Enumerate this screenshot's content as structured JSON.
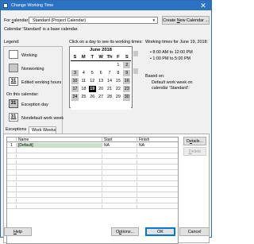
{
  "window": {
    "title": "Change Working Time"
  },
  "for_calendar": {
    "label_pre": "For ",
    "label_key": "c",
    "label_post": "alendar:",
    "value": "Standard (Project Calendar)",
    "note": "Calendar 'Standard' is a base calendar."
  },
  "create_new_calendar": {
    "pre": "Create ",
    "key": "N",
    "post": "ew Calendar ..."
  },
  "legend": {
    "title": "Legend:",
    "items": [
      {
        "label": "Working",
        "glyph": ""
      },
      {
        "label": "Nonworking",
        "glyph": ""
      },
      {
        "label": "Edited working hours",
        "glyph": "31"
      }
    ],
    "on_this_calendar": "On this calendar:",
    "calendar_items": [
      {
        "label": "Exception day",
        "glyph": "31"
      },
      {
        "label": "Nondefault work week",
        "glyph": "31"
      }
    ]
  },
  "calendar": {
    "instruction": "Click on a day to see its working times:",
    "month": "June 2018",
    "day_headers": [
      "S",
      "M",
      "T",
      "W",
      "Th",
      "F",
      "S"
    ],
    "weeks": [
      [
        "",
        "",
        "",
        "",
        "",
        "1",
        "2"
      ],
      [
        "3",
        "4",
        "5",
        "6",
        "7",
        "8",
        "9"
      ],
      [
        "10",
        "11",
        "12",
        "13",
        "14",
        "15",
        "16"
      ],
      [
        "17",
        "18",
        "19",
        "20",
        "21",
        "22",
        "23"
      ],
      [
        "24",
        "25",
        "26",
        "27",
        "28",
        "29",
        "30"
      ],
      [
        "",
        "",
        "",
        "",
        "",
        "",
        ""
      ]
    ],
    "selected_day": "19"
  },
  "working_times": {
    "heading": "Working times for June 19, 2018:",
    "times": [
      "8:00 AM to 12:00 PM",
      "1:00 PM to 5:00 PM"
    ],
    "based_on_label": "Based on:",
    "based_on_text": "Default work week on calendar 'Standard'."
  },
  "tabs": [
    {
      "label": "Exceptions"
    },
    {
      "label": "Work Weeks"
    }
  ],
  "work_weeks_table": {
    "columns": [
      "Name",
      "Start",
      "Finish"
    ],
    "rows": [
      {
        "num": "1",
        "name": "[Default]",
        "start": "NA",
        "finish": "NA"
      }
    ],
    "empty_rows": 11
  },
  "side_buttons": {
    "details": {
      "pre": "D",
      "key": "e",
      "post": "tails..."
    },
    "delete": {
      "pre": "",
      "key": "D",
      "post": "elete"
    }
  },
  "footer": {
    "help": {
      "pre": "",
      "key": "H",
      "post": "elp"
    },
    "options": {
      "pre": "O",
      "key": "p",
      "post": "tions..."
    },
    "ok": "OK",
    "cancel": "Cancel"
  }
}
